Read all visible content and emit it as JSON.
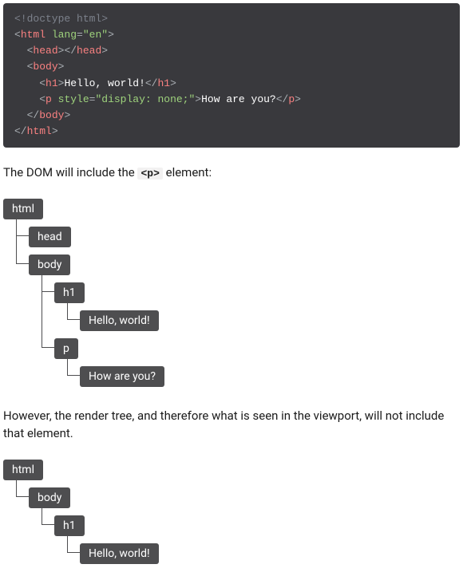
{
  "code": {
    "line1": "<!doctype html>",
    "line2_open_html": "<html ",
    "line2_attr": "lang",
    "line2_eq": "=",
    "line2_val": "\"en\"",
    "line2_close": ">",
    "line3": "<head></head>",
    "line4": "<body>",
    "line5_open": "<h1>",
    "line5_text": "Hello, world!",
    "line5_close": "</h1>",
    "line6_open": "<p ",
    "line6_attr": "style",
    "line6_eq": "=",
    "line6_val": "\"display: none;\"",
    "line6_mid": ">",
    "line6_text": "How are you?",
    "line6_close": "</p>",
    "line7": "</body>",
    "line8": "</html>"
  },
  "text1_pre": "The DOM will include the ",
  "text1_code": "<p>",
  "text1_post": " element:",
  "text2": "However, the render tree, and therefore what is seen in the viewport, will not include that element.",
  "tree1": {
    "root": "html",
    "head": "head",
    "body": "body",
    "h1": "h1",
    "h1_text": "Hello, world!",
    "p": "p",
    "p_text": "How are you?"
  },
  "tree2": {
    "root": "html",
    "body": "body",
    "h1": "h1",
    "h1_text": "Hello, world!"
  }
}
